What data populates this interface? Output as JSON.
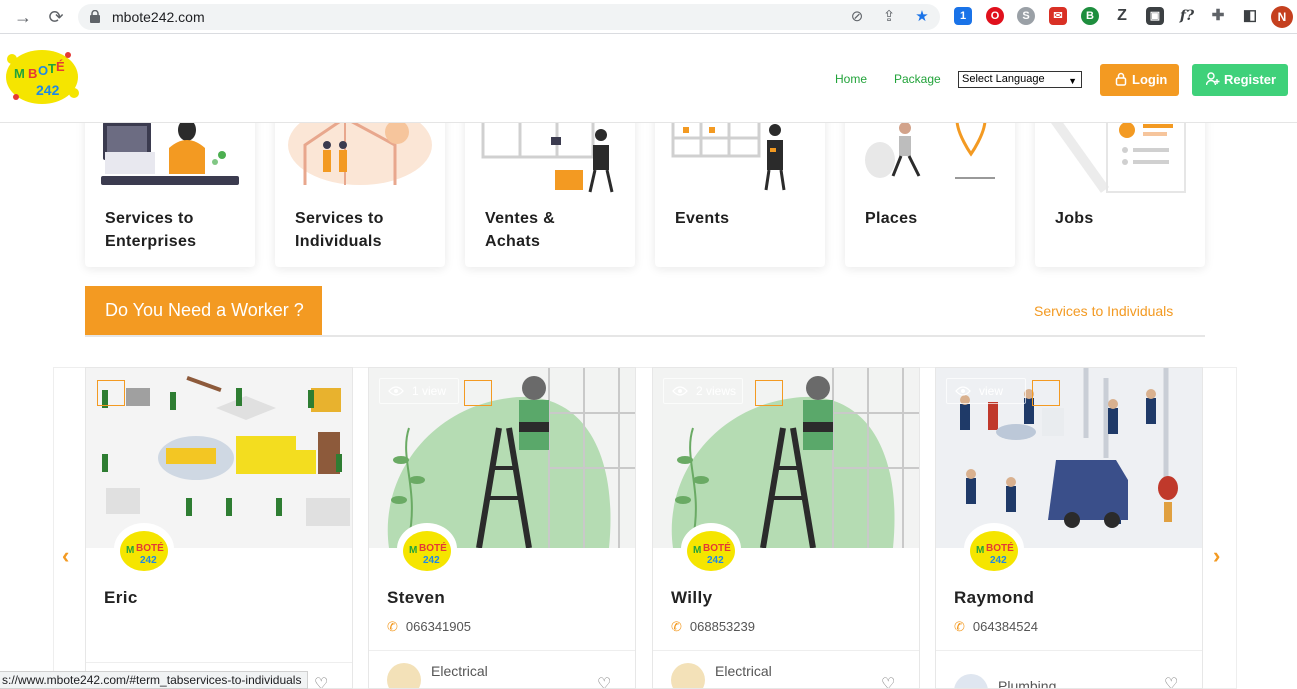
{
  "browser": {
    "url": "mbote242.com",
    "profile_initial": "N",
    "status_url": "s://www.mbote242.com/#term_tabservices-to-individuals"
  },
  "header": {
    "logo_text": "MBOTE 242",
    "nav": [
      {
        "label": "Home"
      },
      {
        "label": "Package"
      }
    ],
    "language_select": "Select Language",
    "login_label": "Login",
    "register_label": "Register"
  },
  "categories": [
    {
      "label_line1": "Services to",
      "label_line2": "Enterprises"
    },
    {
      "label_line1": "Services to",
      "label_line2": "Individuals"
    },
    {
      "label_line1": "Ventes &",
      "label_line2": "Achats"
    },
    {
      "label_line1": "Events",
      "label_line2": ""
    },
    {
      "label_line1": "Places",
      "label_line2": ""
    },
    {
      "label_line1": "Jobs",
      "label_line2": ""
    }
  ],
  "section": {
    "title": "Do You Need a Worker ?",
    "link": "Services to Individuals"
  },
  "workers": [
    {
      "name": "Eric",
      "phone": "",
      "views": "",
      "category": ""
    },
    {
      "name": "Steven",
      "phone": "066341905",
      "views": "1 view",
      "category": "Electrical"
    },
    {
      "name": "Willy",
      "phone": "068853239",
      "views": "2 views",
      "category": "Electrical"
    },
    {
      "name": "Raymond",
      "phone": "064384524",
      "views": "view",
      "category": "Plumbing"
    }
  ],
  "colors": {
    "accent": "#f39a22",
    "green_nav": "#22a33a",
    "register": "#3fd17a"
  }
}
